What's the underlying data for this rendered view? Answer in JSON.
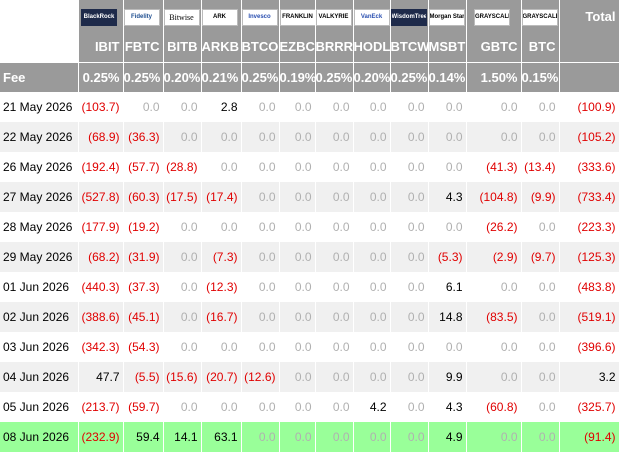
{
  "header": {
    "total_label": "Total",
    "fee_label": "Fee",
    "issuers": [
      {
        "logo": "BlackRock",
        "logo_icon": "blackrock-logo-icon",
        "ticker": "IBIT",
        "fee": "0.25%"
      },
      {
        "logo": "Fidelity",
        "logo_icon": "fidelity-logo-icon",
        "ticker": "FBTC",
        "fee": "0.25%"
      },
      {
        "logo": "Bitwise",
        "logo_icon": "bitwise-logo-icon",
        "ticker": "BITB",
        "fee": "0.20%"
      },
      {
        "logo": "ARK",
        "logo_icon": "ark-logo-icon",
        "ticker": "ARKB",
        "fee": "0.21%"
      },
      {
        "logo": "Invesco",
        "logo_icon": "invesco-logo-icon",
        "ticker": "BTCO",
        "fee": "0.25%"
      },
      {
        "logo": "FRANKLIN",
        "logo_icon": "franklin-templeton-logo-icon",
        "ticker": "EZBC",
        "fee": "0.19%"
      },
      {
        "logo": "VALKYRIE",
        "logo_icon": "valkyrie-logo-icon",
        "ticker": "BRRR",
        "fee": "0.25%"
      },
      {
        "logo": "VanEck",
        "logo_icon": "vaneck-logo-icon",
        "ticker": "HODL",
        "fee": "0.20%"
      },
      {
        "logo": "WisdomTree",
        "logo_icon": "wisdomtree-logo-icon",
        "ticker": "BTCW",
        "fee": "0.25%"
      },
      {
        "logo": "Morgan Stanley",
        "logo_icon": "morgan-stanley-logo-icon",
        "ticker": "MSBT",
        "fee": "0.14%"
      },
      {
        "logo": "GRAYSCALE",
        "logo_icon": "grayscale-logo-icon",
        "ticker": "GBTC",
        "fee": "1.50%"
      },
      {
        "logo": "GRAYSCALE",
        "logo_icon": "grayscale-logo-icon",
        "ticker": "BTC",
        "fee": "0.15%"
      }
    ]
  },
  "rows": [
    {
      "date": "21 May 2026",
      "values": [
        "(103.7)",
        "0.0",
        "0.0",
        "2.8",
        "0.0",
        "0.0",
        "0.0",
        "0.0",
        "0.0",
        "0.0",
        "0.0",
        "0.0"
      ],
      "total": "(100.9)"
    },
    {
      "date": "22 May 2026",
      "values": [
        "(68.9)",
        "(36.3)",
        "0.0",
        "0.0",
        "0.0",
        "0.0",
        "0.0",
        "0.0",
        "0.0",
        "0.0",
        "0.0",
        "0.0"
      ],
      "total": "(105.2)"
    },
    {
      "date": "26 May 2026",
      "values": [
        "(192.4)",
        "(57.7)",
        "(28.8)",
        "0.0",
        "0.0",
        "0.0",
        "0.0",
        "0.0",
        "0.0",
        "0.0",
        "(41.3)",
        "(13.4)"
      ],
      "total": "(333.6)"
    },
    {
      "date": "27 May 2026",
      "values": [
        "(527.8)",
        "(60.3)",
        "(17.5)",
        "(17.4)",
        "0.0",
        "0.0",
        "0.0",
        "0.0",
        "0.0",
        "4.3",
        "(104.8)",
        "(9.9)"
      ],
      "total": "(733.4)"
    },
    {
      "date": "28 May 2026",
      "values": [
        "(177.9)",
        "(19.2)",
        "0.0",
        "0.0",
        "0.0",
        "0.0",
        "0.0",
        "0.0",
        "0.0",
        "0.0",
        "(26.2)",
        "0.0"
      ],
      "total": "(223.3)"
    },
    {
      "date": "29 May 2026",
      "values": [
        "(68.2)",
        "(31.9)",
        "0.0",
        "(7.3)",
        "0.0",
        "0.0",
        "0.0",
        "0.0",
        "0.0",
        "(5.3)",
        "(2.9)",
        "(9.7)"
      ],
      "total": "(125.3)"
    },
    {
      "date": "01 Jun 2026",
      "values": [
        "(440.3)",
        "(37.3)",
        "0.0",
        "(12.3)",
        "0.0",
        "0.0",
        "0.0",
        "0.0",
        "0.0",
        "6.1",
        "0.0",
        "0.0"
      ],
      "total": "(483.8)"
    },
    {
      "date": "02 Jun 2026",
      "values": [
        "(388.6)",
        "(45.1)",
        "0.0",
        "(16.7)",
        "0.0",
        "0.0",
        "0.0",
        "0.0",
        "0.0",
        "14.8",
        "(83.5)",
        "0.0"
      ],
      "total": "(519.1)"
    },
    {
      "date": "03 Jun 2026",
      "values": [
        "(342.3)",
        "(54.3)",
        "0.0",
        "0.0",
        "0.0",
        "0.0",
        "0.0",
        "0.0",
        "0.0",
        "0.0",
        "0.0",
        "0.0"
      ],
      "total": "(396.6)"
    },
    {
      "date": "04 Jun 2026",
      "values": [
        "47.7",
        "(5.5)",
        "(15.6)",
        "(20.7)",
        "(12.6)",
        "0.0",
        "0.0",
        "0.0",
        "0.0",
        "9.9",
        "0.0",
        "0.0"
      ],
      "total": "3.2"
    },
    {
      "date": "05 Jun 2026",
      "values": [
        "(213.7)",
        "(59.7)",
        "0.0",
        "0.0",
        "0.0",
        "0.0",
        "0.0",
        "4.2",
        "0.0",
        "4.3",
        "(60.8)",
        "0.0"
      ],
      "total": "(325.7)"
    },
    {
      "date": "08 Jun 2026",
      "values": [
        "(232.9)",
        "59.4",
        "14.1",
        "63.1",
        "0.0",
        "0.0",
        "0.0",
        "0.0",
        "0.0",
        "4.9",
        "0.0",
        "0.0"
      ],
      "total": "(91.4)",
      "highlight": true
    }
  ],
  "colors": {
    "header_bg": "#9a9a9a",
    "negative": "#e00000",
    "zero": "#b0b0b0",
    "highlight_row": "#99ff99",
    "alt_row": "#f0f0f0"
  }
}
